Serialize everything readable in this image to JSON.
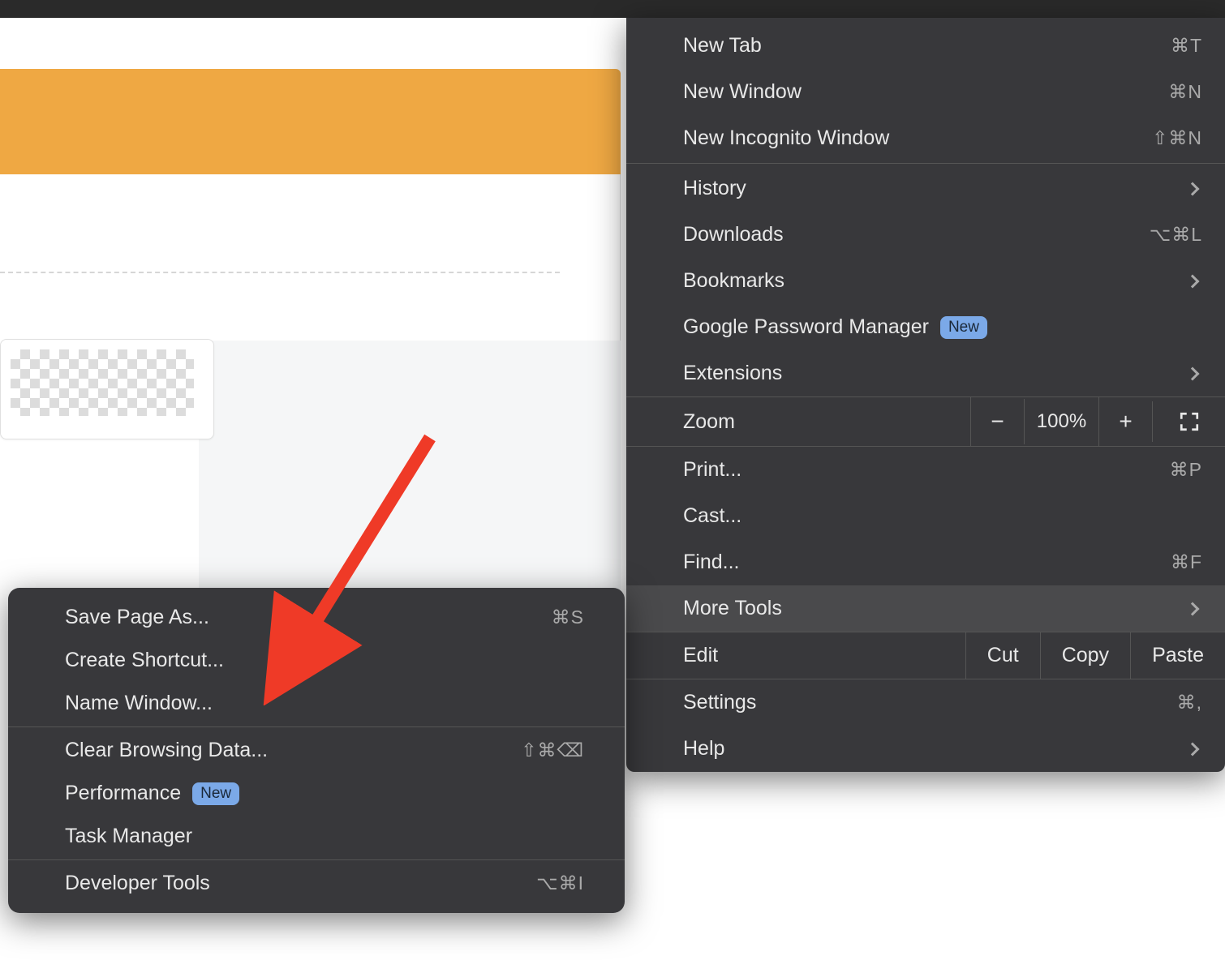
{
  "mainMenu": {
    "group1": [
      {
        "label": "New Tab",
        "shortcut": "⌘T"
      },
      {
        "label": "New Window",
        "shortcut": "⌘N"
      },
      {
        "label": "New Incognito Window",
        "shortcut": "⇧⌘N"
      }
    ],
    "group2": [
      {
        "label": "History",
        "hasSubmenu": true
      },
      {
        "label": "Downloads",
        "shortcut": "⌥⌘L"
      },
      {
        "label": "Bookmarks",
        "hasSubmenu": true
      },
      {
        "label": "Google Password Manager",
        "badge": "New"
      },
      {
        "label": "Extensions",
        "hasSubmenu": true
      }
    ],
    "zoom": {
      "label": "Zoom",
      "value": "100%",
      "minus": "−",
      "plus": "+"
    },
    "group3": [
      {
        "label": "Print...",
        "shortcut": "⌘P"
      },
      {
        "label": "Cast..."
      },
      {
        "label": "Find...",
        "shortcut": "⌘F"
      },
      {
        "label": "More Tools",
        "hasSubmenu": true,
        "highlighted": true
      }
    ],
    "edit": {
      "label": "Edit",
      "cut": "Cut",
      "copy": "Copy",
      "paste": "Paste"
    },
    "group4": [
      {
        "label": "Settings",
        "shortcut": "⌘,"
      },
      {
        "label": "Help",
        "hasSubmenu": true
      }
    ]
  },
  "submenu": {
    "group1": [
      {
        "label": "Save Page As...",
        "shortcut": "⌘S"
      },
      {
        "label": "Create Shortcut..."
      },
      {
        "label": "Name Window..."
      }
    ],
    "group2": [
      {
        "label": "Clear Browsing Data...",
        "shortcut": "⇧⌘⌫"
      },
      {
        "label": "Performance",
        "badge": "New"
      },
      {
        "label": "Task Manager"
      }
    ],
    "group3": [
      {
        "label": "Developer Tools",
        "shortcut": "⌥⌘I"
      }
    ]
  },
  "annotations": {
    "arrowTarget": "Create Shortcut..."
  }
}
